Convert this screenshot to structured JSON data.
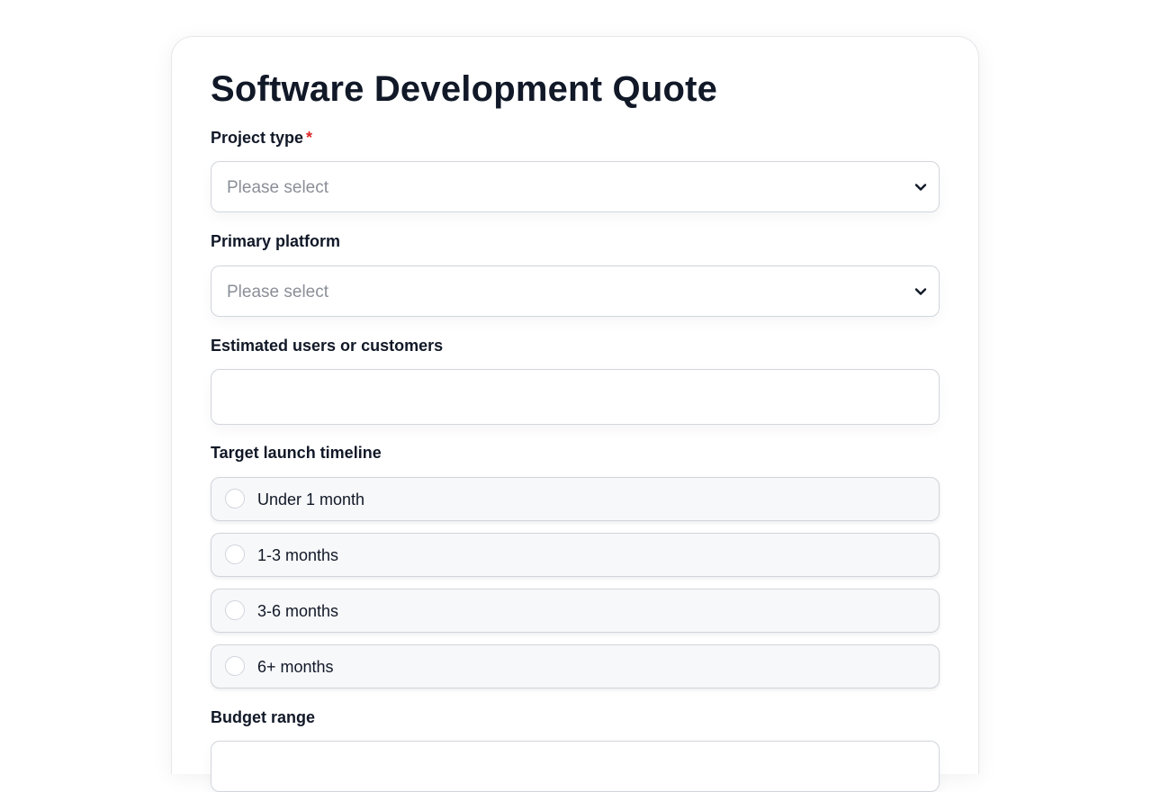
{
  "form": {
    "title": "Software Development Quote",
    "project_type": {
      "label": "Project type",
      "required_marker": "*",
      "placeholder": "Please select"
    },
    "primary_platform": {
      "label": "Primary platform",
      "placeholder": "Please select"
    },
    "estimated_users": {
      "label": "Estimated users or customers",
      "value": ""
    },
    "timeline": {
      "label": "Target launch timeline",
      "options": [
        "Under 1 month",
        "1-3 months",
        "3-6 months",
        "6+ months"
      ]
    },
    "budget": {
      "label": "Budget range"
    }
  },
  "icons": {
    "select_chevron": "chevron-down-icon"
  }
}
